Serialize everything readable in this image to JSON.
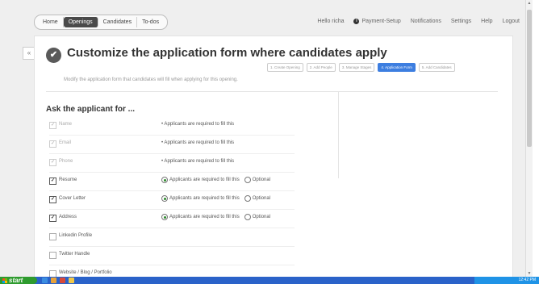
{
  "nav": {
    "tabs": [
      "Home",
      "Openings",
      "Candidates",
      "To-dos"
    ],
    "active": "Openings",
    "links": [
      "Hello richa",
      "Payment-Setup",
      "Notifications",
      "Settings",
      "Help",
      "Logout"
    ]
  },
  "header": {
    "title": "Customize the application form where candidates apply",
    "subtitle": "Modify the application form that candidates will fill when applying for this opening."
  },
  "steps": [
    "1. Create Opening",
    "2. Add People",
    "3. Manage Stages",
    "4. Application Form",
    "5. Add Candidates"
  ],
  "active_step": "4. Application Form",
  "form": {
    "heading": "Ask the applicant for ...",
    "required_text": "• Applicants are required to fill this",
    "required_radio_text": "Applicants are required to fill this",
    "optional_text": "Optional",
    "fields": [
      {
        "label": "Name",
        "checked": true,
        "disabled": true,
        "mode": "required"
      },
      {
        "label": "Email",
        "checked": true,
        "disabled": true,
        "mode": "required"
      },
      {
        "label": "Phone",
        "checked": true,
        "disabled": true,
        "mode": "required"
      },
      {
        "label": "Resume",
        "checked": true,
        "disabled": false,
        "mode": "choice"
      },
      {
        "label": "Cover Letter",
        "checked": true,
        "disabled": false,
        "mode": "choice"
      },
      {
        "label": "Address",
        "checked": true,
        "disabled": false,
        "mode": "choice"
      },
      {
        "label": "Linkedin Profile",
        "checked": false,
        "disabled": false,
        "mode": "none"
      },
      {
        "label": "Twitter Handle",
        "checked": false,
        "disabled": false,
        "mode": "none"
      },
      {
        "label": "Website / Blog / Portfolio",
        "checked": false,
        "disabled": false,
        "mode": "none"
      }
    ]
  },
  "taskbar": {
    "start": "start",
    "clock": "12:42 PM"
  },
  "colors": {
    "active_step": "#3d7ee0",
    "taskbar": "#2a62c9",
    "start_button": "#2e9b2e",
    "radio_selected": "#2d8a2d"
  }
}
